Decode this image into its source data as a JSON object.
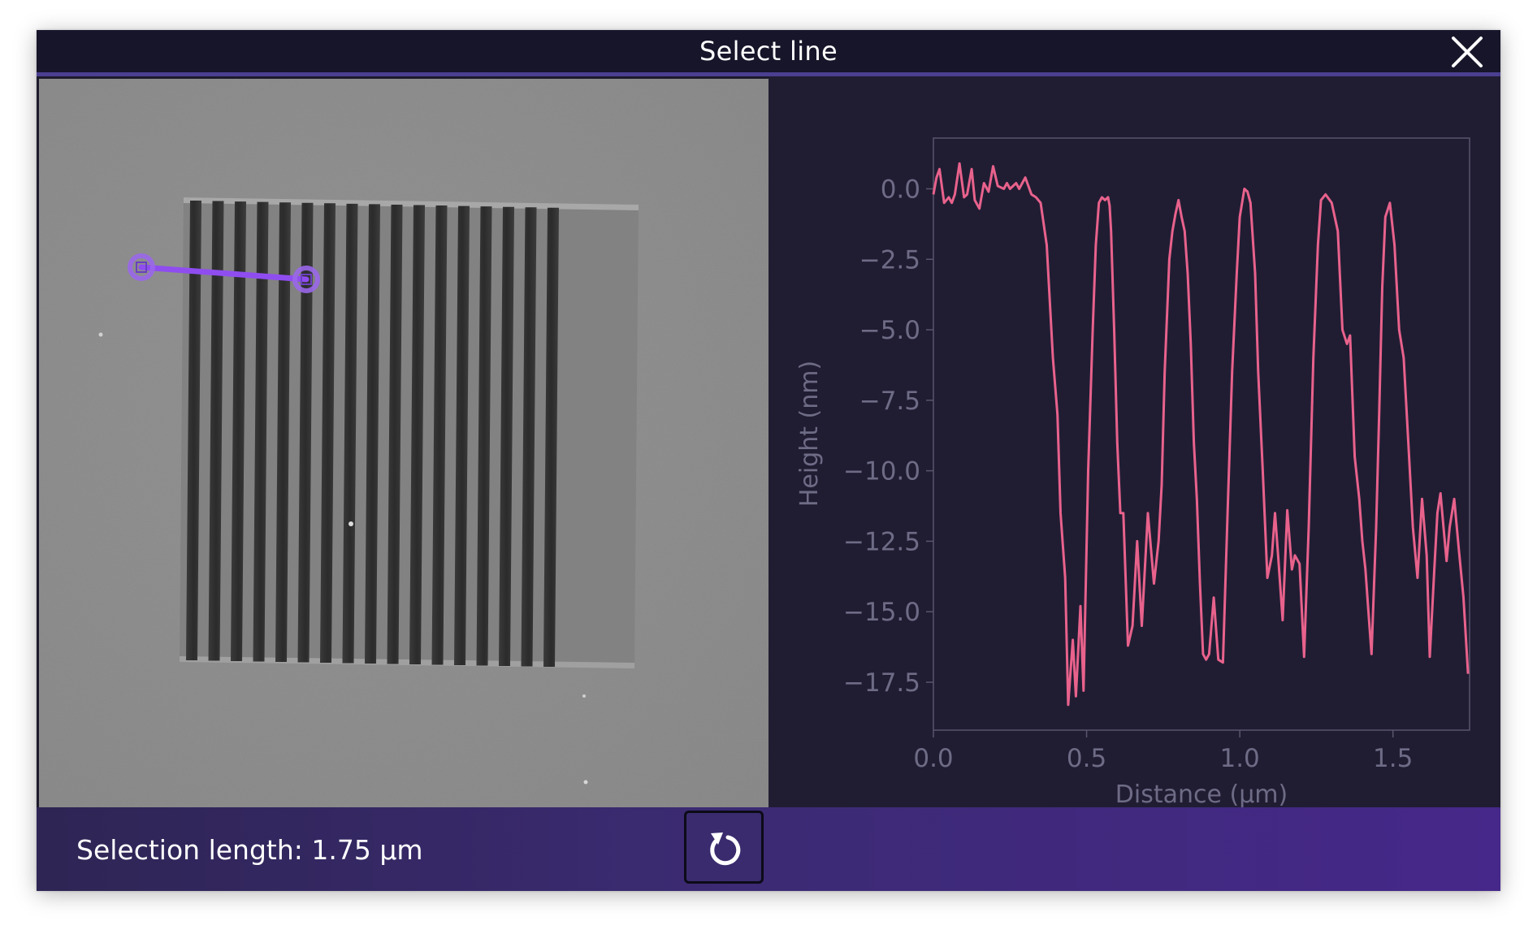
{
  "dialog": {
    "title": "Select line",
    "close_icon": "close-icon"
  },
  "image_view": {
    "description_icon": "afm-scan-image",
    "selection_line_color": "#8f4df0",
    "handle_color": "#9a67ea",
    "grating_bar_count": 17
  },
  "footer": {
    "selection_label": "Selection length: 1.75 µm",
    "reset_icon": "reset-icon"
  },
  "colors": {
    "titlebar": "#16152a",
    "titlebar_border": "#4b3f91",
    "plot_background": "#201d33",
    "line": "#e8628c",
    "footer_start": "#2e2554",
    "footer_end": "#46288a"
  },
  "chart_data": {
    "type": "line",
    "title": "",
    "xlabel": "Distance (µm)",
    "ylabel": "Height (nm)",
    "xlim": [
      0,
      1.75
    ],
    "ylim": [
      -19.2,
      1.8
    ],
    "xticks": [
      0.0,
      0.5,
      1.0,
      1.5
    ],
    "xtick_labels": [
      "0.0",
      "0.5",
      "1.0",
      "1.5"
    ],
    "yticks": [
      0.0,
      -2.5,
      -5.0,
      -7.5,
      -10.0,
      -12.5,
      -15.0,
      -17.5
    ],
    "ytick_labels": [
      "0.0",
      "−2.5",
      "−5.0",
      "−7.5",
      "−10.0",
      "−12.5",
      "−15.0",
      "−17.5"
    ],
    "grid": false,
    "series": [
      {
        "color": "#e8628c",
        "x": [
          0.0,
          0.01,
          0.02,
          0.035,
          0.05,
          0.06,
          0.07,
          0.085,
          0.1,
          0.11,
          0.125,
          0.135,
          0.15,
          0.165,
          0.18,
          0.195,
          0.21,
          0.23,
          0.24,
          0.25,
          0.27,
          0.28,
          0.3,
          0.32,
          0.335,
          0.35,
          0.37,
          0.39,
          0.405,
          0.415,
          0.43,
          0.44,
          0.455,
          0.465,
          0.48,
          0.49,
          0.505,
          0.52,
          0.53,
          0.54,
          0.55,
          0.56,
          0.57,
          0.575,
          0.58,
          0.59,
          0.6,
          0.61,
          0.62,
          0.635,
          0.65,
          0.665,
          0.68,
          0.7,
          0.72,
          0.735,
          0.745,
          0.755,
          0.77,
          0.78,
          0.79,
          0.8,
          0.81,
          0.82,
          0.83,
          0.84,
          0.85,
          0.86,
          0.87,
          0.88,
          0.89,
          0.9,
          0.915,
          0.93,
          0.945,
          0.96,
          0.975,
          0.99,
          1.0,
          1.015,
          1.025,
          1.035,
          1.05,
          1.06,
          1.075,
          1.09,
          1.105,
          1.115,
          1.125,
          1.14,
          1.155,
          1.17,
          1.18,
          1.195,
          1.21,
          1.225,
          1.24,
          1.255,
          1.265,
          1.28,
          1.3,
          1.32,
          1.335,
          1.35,
          1.36,
          1.375,
          1.39,
          1.4,
          1.41,
          1.42,
          1.43,
          1.445,
          1.455,
          1.465,
          1.475,
          1.49,
          1.505,
          1.52,
          1.535,
          1.55,
          1.565,
          1.58,
          1.595,
          1.61,
          1.62,
          1.635,
          1.645,
          1.655,
          1.665,
          1.675,
          1.685,
          1.7,
          1.715,
          1.73,
          1.745
        ],
        "y": [
          -0.2,
          0.4,
          0.7,
          -0.5,
          -0.3,
          -0.5,
          -0.2,
          0.9,
          -0.3,
          -0.2,
          0.7,
          -0.4,
          -0.7,
          0.2,
          -0.1,
          0.8,
          0.1,
          0.0,
          0.2,
          0.0,
          0.2,
          0.0,
          0.4,
          -0.2,
          -0.3,
          -0.5,
          -2.0,
          -6.0,
          -8.0,
          -11.5,
          -13.8,
          -18.3,
          -16.0,
          -18.0,
          -14.8,
          -17.8,
          -10.0,
          -5.0,
          -2.0,
          -0.5,
          -0.3,
          -0.4,
          -0.3,
          -0.6,
          -1.5,
          -5.0,
          -9.0,
          -11.5,
          -11.5,
          -16.2,
          -15.5,
          -12.5,
          -15.5,
          -11.5,
          -14.0,
          -12.5,
          -10.5,
          -6.5,
          -2.5,
          -1.5,
          -0.9,
          -0.4,
          -1.0,
          -1.5,
          -3.0,
          -5.5,
          -9.0,
          -11.0,
          -14.0,
          -16.5,
          -16.7,
          -16.5,
          -14.5,
          -16.7,
          -16.8,
          -11.5,
          -6.5,
          -3.0,
          -1.0,
          0.0,
          -0.1,
          -0.5,
          -3.0,
          -6.5,
          -10.0,
          -13.8,
          -13.0,
          -11.5,
          -13.0,
          -15.3,
          -11.4,
          -13.5,
          -13.0,
          -13.3,
          -16.6,
          -12.0,
          -6.0,
          -2.0,
          -0.4,
          -0.2,
          -0.5,
          -1.5,
          -5.0,
          -5.5,
          -5.2,
          -9.5,
          -11.0,
          -12.5,
          -13.5,
          -15.0,
          -16.5,
          -12.0,
          -8.0,
          -3.5,
          -1.0,
          -0.5,
          -2.0,
          -5.0,
          -6.0,
          -9.0,
          -12.0,
          -13.8,
          -11.0,
          -13.0,
          -16.6,
          -13.5,
          -11.5,
          -10.8,
          -12.0,
          -13.2,
          -12.0,
          -11.0,
          -12.8,
          -14.5,
          -17.2
        ]
      }
    ]
  }
}
